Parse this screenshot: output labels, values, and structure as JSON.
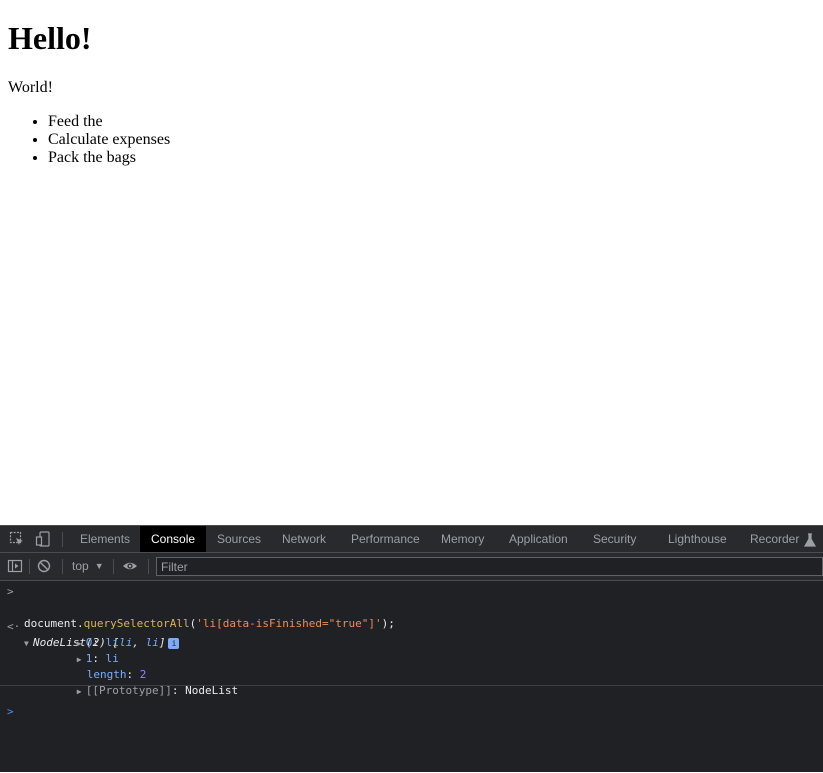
{
  "page": {
    "heading": "Hello!",
    "paragraph": "World!",
    "list_items": [
      "Feed the",
      "Calculate expenses",
      "Pack the bags"
    ]
  },
  "devtools": {
    "tabs": [
      "Elements",
      "Console",
      "Sources",
      "Network",
      "Performance",
      "Memory",
      "Application",
      "Security",
      "Lighthouse",
      "Recorder"
    ],
    "active_tab": "Console",
    "context": "top",
    "filter_placeholder": "Filter",
    "console": {
      "input": {
        "obj": "document",
        "dot": ".",
        "method": "querySelectorAll",
        "open": "(",
        "arg": "'li[data-isFinished=\"true\"]'",
        "close": ");"
      },
      "result_head": {
        "type": "NodeList(2)",
        "preview_open": "[",
        "item1": "li",
        "comma": ", ",
        "item2": "li",
        "preview_close": "]",
        "badge": "i"
      },
      "entries": [
        {
          "key": "0",
          "value": "li"
        },
        {
          "key": "1",
          "value": "li"
        }
      ],
      "length_key": "length",
      "length_value": "2",
      "proto_key": "[[Prototype]]",
      "proto_value": "NodeList"
    },
    "colors": {
      "background": "#202124",
      "toolbar": "#292a2d",
      "active_tab": "#000000",
      "string": "#f28b54",
      "number": "#9980ff",
      "key": "#7cacf8"
    }
  }
}
